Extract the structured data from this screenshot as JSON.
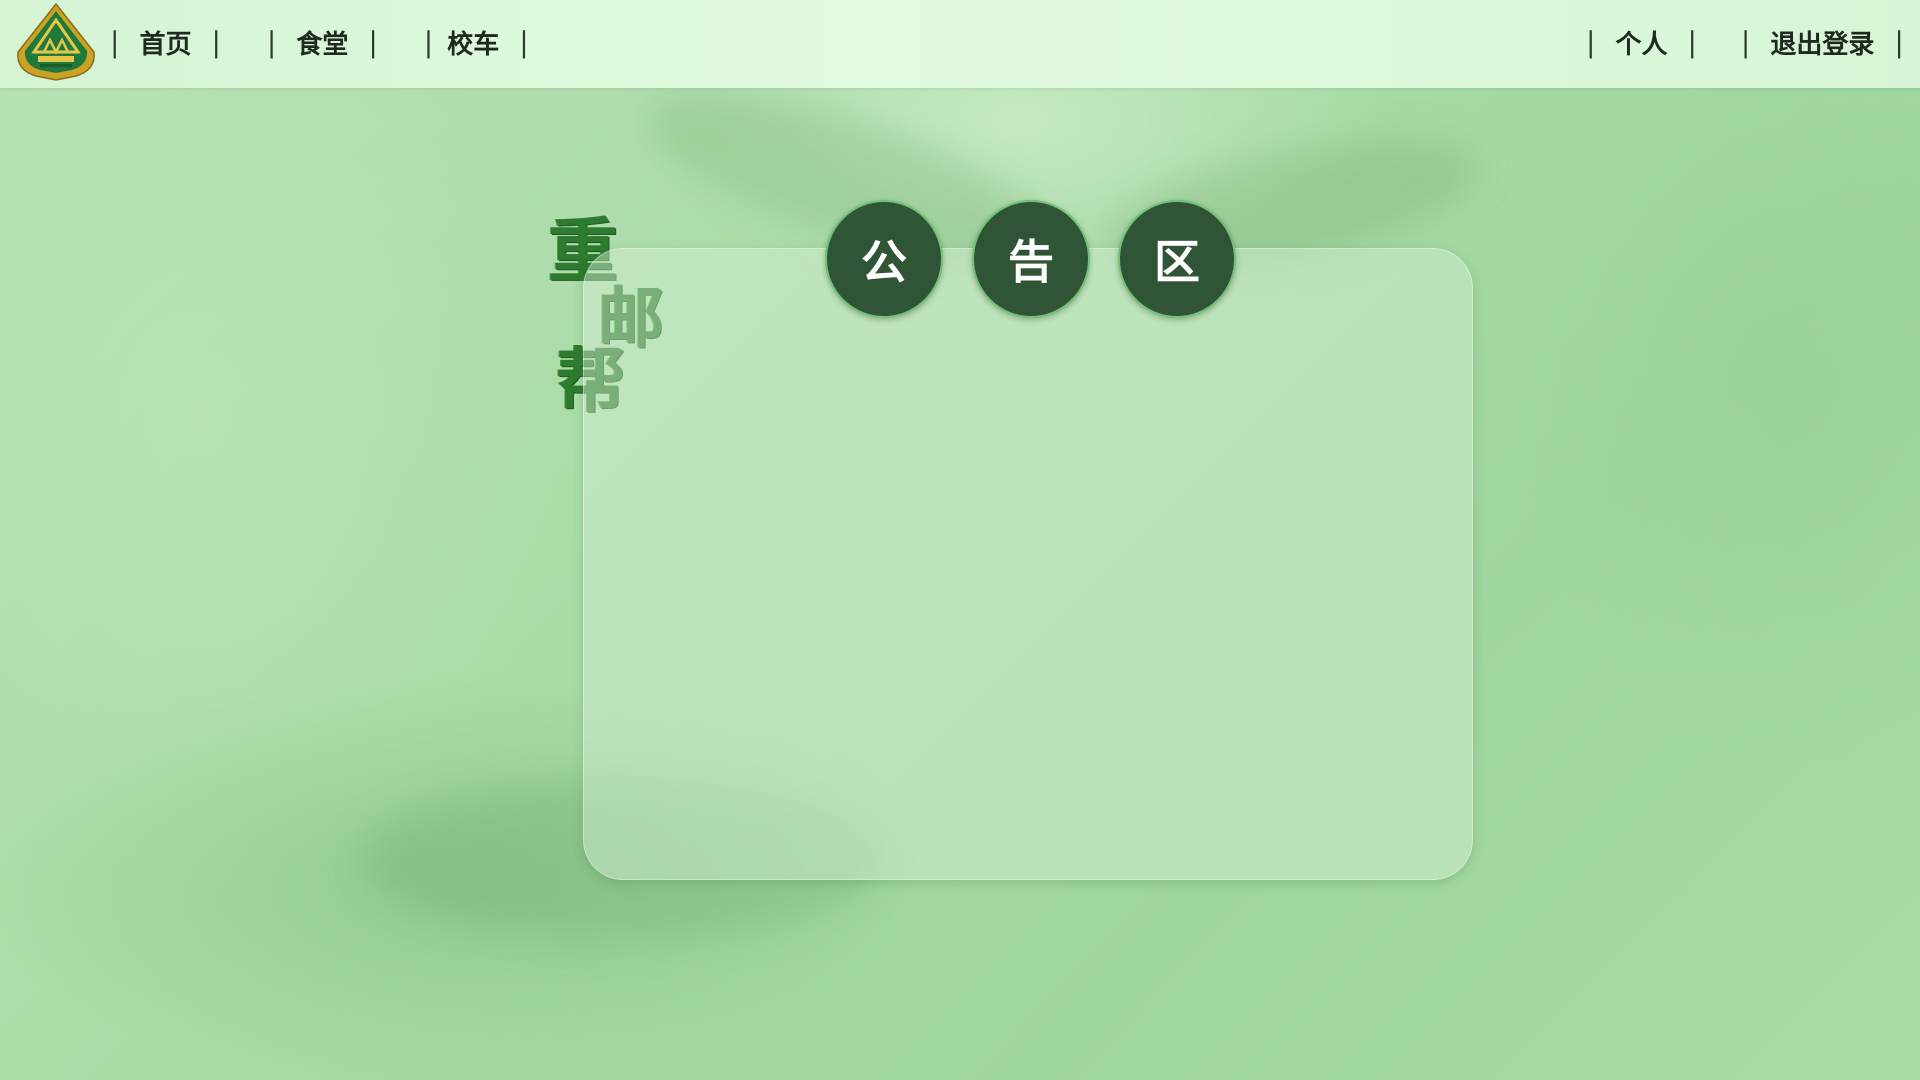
{
  "nav": {
    "left": [
      {
        "label": "首页"
      },
      {
        "label": "食堂"
      },
      {
        "label": "校车"
      }
    ],
    "right": [
      {
        "label": "个人"
      },
      {
        "label": "退出登录"
      }
    ],
    "separator": "|"
  },
  "brand": {
    "chars": [
      "重",
      "邮",
      "帮"
    ]
  },
  "notice": {
    "chars": [
      "公",
      "告",
      "区"
    ]
  },
  "colors": {
    "topbar": "#dcf7dc",
    "circle": "#2f5536",
    "circle_border": "#6fc276",
    "brand_text": "#2e7a30",
    "background": "#a9dba7"
  },
  "icons": {
    "logo": "university-emblem-icon"
  }
}
